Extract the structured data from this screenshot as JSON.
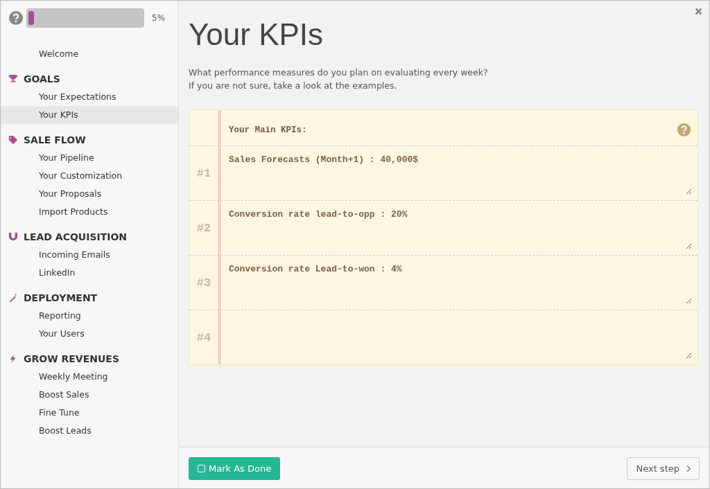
{
  "progress": {
    "level": 0.05,
    "reading": "5%"
  },
  "sidebar": {
    "top_items": [
      {
        "label": "Welcome",
        "selected": false
      }
    ],
    "sections": [
      {
        "kind": "trophy",
        "title": "GOALS",
        "items": [
          {
            "label": "Your Expectations",
            "selected": false
          },
          {
            "label": "Your KPIs",
            "selected": true
          }
        ]
      },
      {
        "kind": "tag",
        "title": "SALE FLOW",
        "items": [
          {
            "label": "Your Pipeline",
            "selected": false
          },
          {
            "label": "Your Customization",
            "selected": false
          },
          {
            "label": "Your Proposals",
            "selected": false
          },
          {
            "label": "Import Products",
            "selected": false
          }
        ]
      },
      {
        "kind": "magnet",
        "title": "LEAD ACQUISITION",
        "items": [
          {
            "label": "Incoming Emails",
            "selected": false
          },
          {
            "label": "LinkedIn",
            "selected": false
          }
        ]
      },
      {
        "kind": "wand",
        "title": "DEPLOYMENT",
        "items": [
          {
            "label": "Reporting",
            "selected": false
          },
          {
            "label": "Your Users",
            "selected": false
          }
        ]
      },
      {
        "kind": "bolt",
        "title": "GROW REVENUES",
        "items": [
          {
            "label": "Weekly Meeting",
            "selected": false
          },
          {
            "label": "Boost Sales",
            "selected": false
          },
          {
            "label": "Fine Tune",
            "selected": false
          },
          {
            "label": "Boost Leads",
            "selected": false
          }
        ]
      }
    ]
  },
  "page": {
    "title": "Your KPIs",
    "intro": [
      "What performance measures do you plan on evaluating every week?",
      "If you are not sure, take a look at the examples."
    ]
  },
  "kpi_sheet": {
    "heading": "Your Main KPIs:",
    "rows": [
      {
        "number": "#1",
        "value": "Sales Forecasts (Month+1) : 40,000$"
      },
      {
        "number": "#2",
        "value": "Conversion rate lead-to-opp : 20%"
      },
      {
        "number": "#3",
        "value": "Conversion rate Lead-to-won : 4%"
      },
      {
        "number": "#4",
        "value": ""
      }
    ]
  },
  "footer": {
    "done_button": "Mark As Done",
    "next_button": "Next step"
  }
}
